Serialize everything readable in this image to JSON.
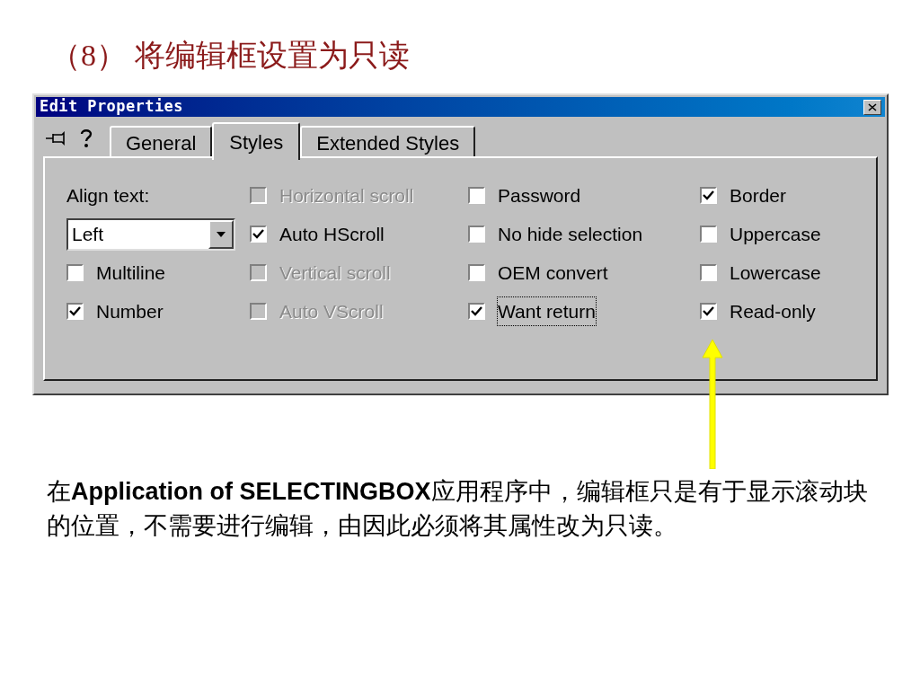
{
  "slide_title": "（8） 将编辑框设置为只读",
  "dialog": {
    "title": "Edit Properties",
    "tabs": [
      {
        "label": "General",
        "selected": false
      },
      {
        "label": "Styles",
        "selected": true
      },
      {
        "label": "Extended Styles",
        "selected": false
      }
    ],
    "columns": [
      [
        {
          "kind": "label",
          "text": "Align text:"
        },
        {
          "kind": "dropdown",
          "value": "Left"
        },
        {
          "kind": "checkbox",
          "label": "Multiline",
          "checked": false,
          "disabled": false,
          "focused": false
        },
        {
          "kind": "checkbox",
          "label": "Number",
          "checked": true,
          "disabled": false,
          "focused": false
        }
      ],
      [
        {
          "kind": "checkbox",
          "label": "Horizontal scroll",
          "checked": false,
          "disabled": true,
          "focused": false
        },
        {
          "kind": "checkbox",
          "label": "Auto HScroll",
          "checked": true,
          "disabled": false,
          "focused": false
        },
        {
          "kind": "checkbox",
          "label": "Vertical scroll",
          "checked": false,
          "disabled": true,
          "focused": false
        },
        {
          "kind": "checkbox",
          "label": "Auto VScroll",
          "checked": false,
          "disabled": true,
          "focused": false
        }
      ],
      [
        {
          "kind": "checkbox",
          "label": "Password",
          "checked": false,
          "disabled": false,
          "focused": false
        },
        {
          "kind": "checkbox",
          "label": "No hide selection",
          "checked": false,
          "disabled": false,
          "focused": false
        },
        {
          "kind": "checkbox",
          "label": "OEM convert",
          "checked": false,
          "disabled": false,
          "focused": false
        },
        {
          "kind": "checkbox",
          "label": "Want return",
          "checked": true,
          "disabled": false,
          "focused": true
        }
      ],
      [
        {
          "kind": "checkbox",
          "label": "Border",
          "checked": true,
          "disabled": false,
          "focused": false
        },
        {
          "kind": "checkbox",
          "label": "Uppercase",
          "checked": false,
          "disabled": false,
          "focused": false
        },
        {
          "kind": "checkbox",
          "label": "Lowercase",
          "checked": false,
          "disabled": false,
          "focused": false
        },
        {
          "kind": "checkbox",
          "label": "Read-only",
          "checked": true,
          "disabled": false,
          "focused": false
        }
      ]
    ]
  },
  "caption": "在**Application of SELECTINGBOX**应用程序中，编辑框只是有于显示滚动块的位置，不需要进行编辑，由因此必须将其属性改为只读。"
}
